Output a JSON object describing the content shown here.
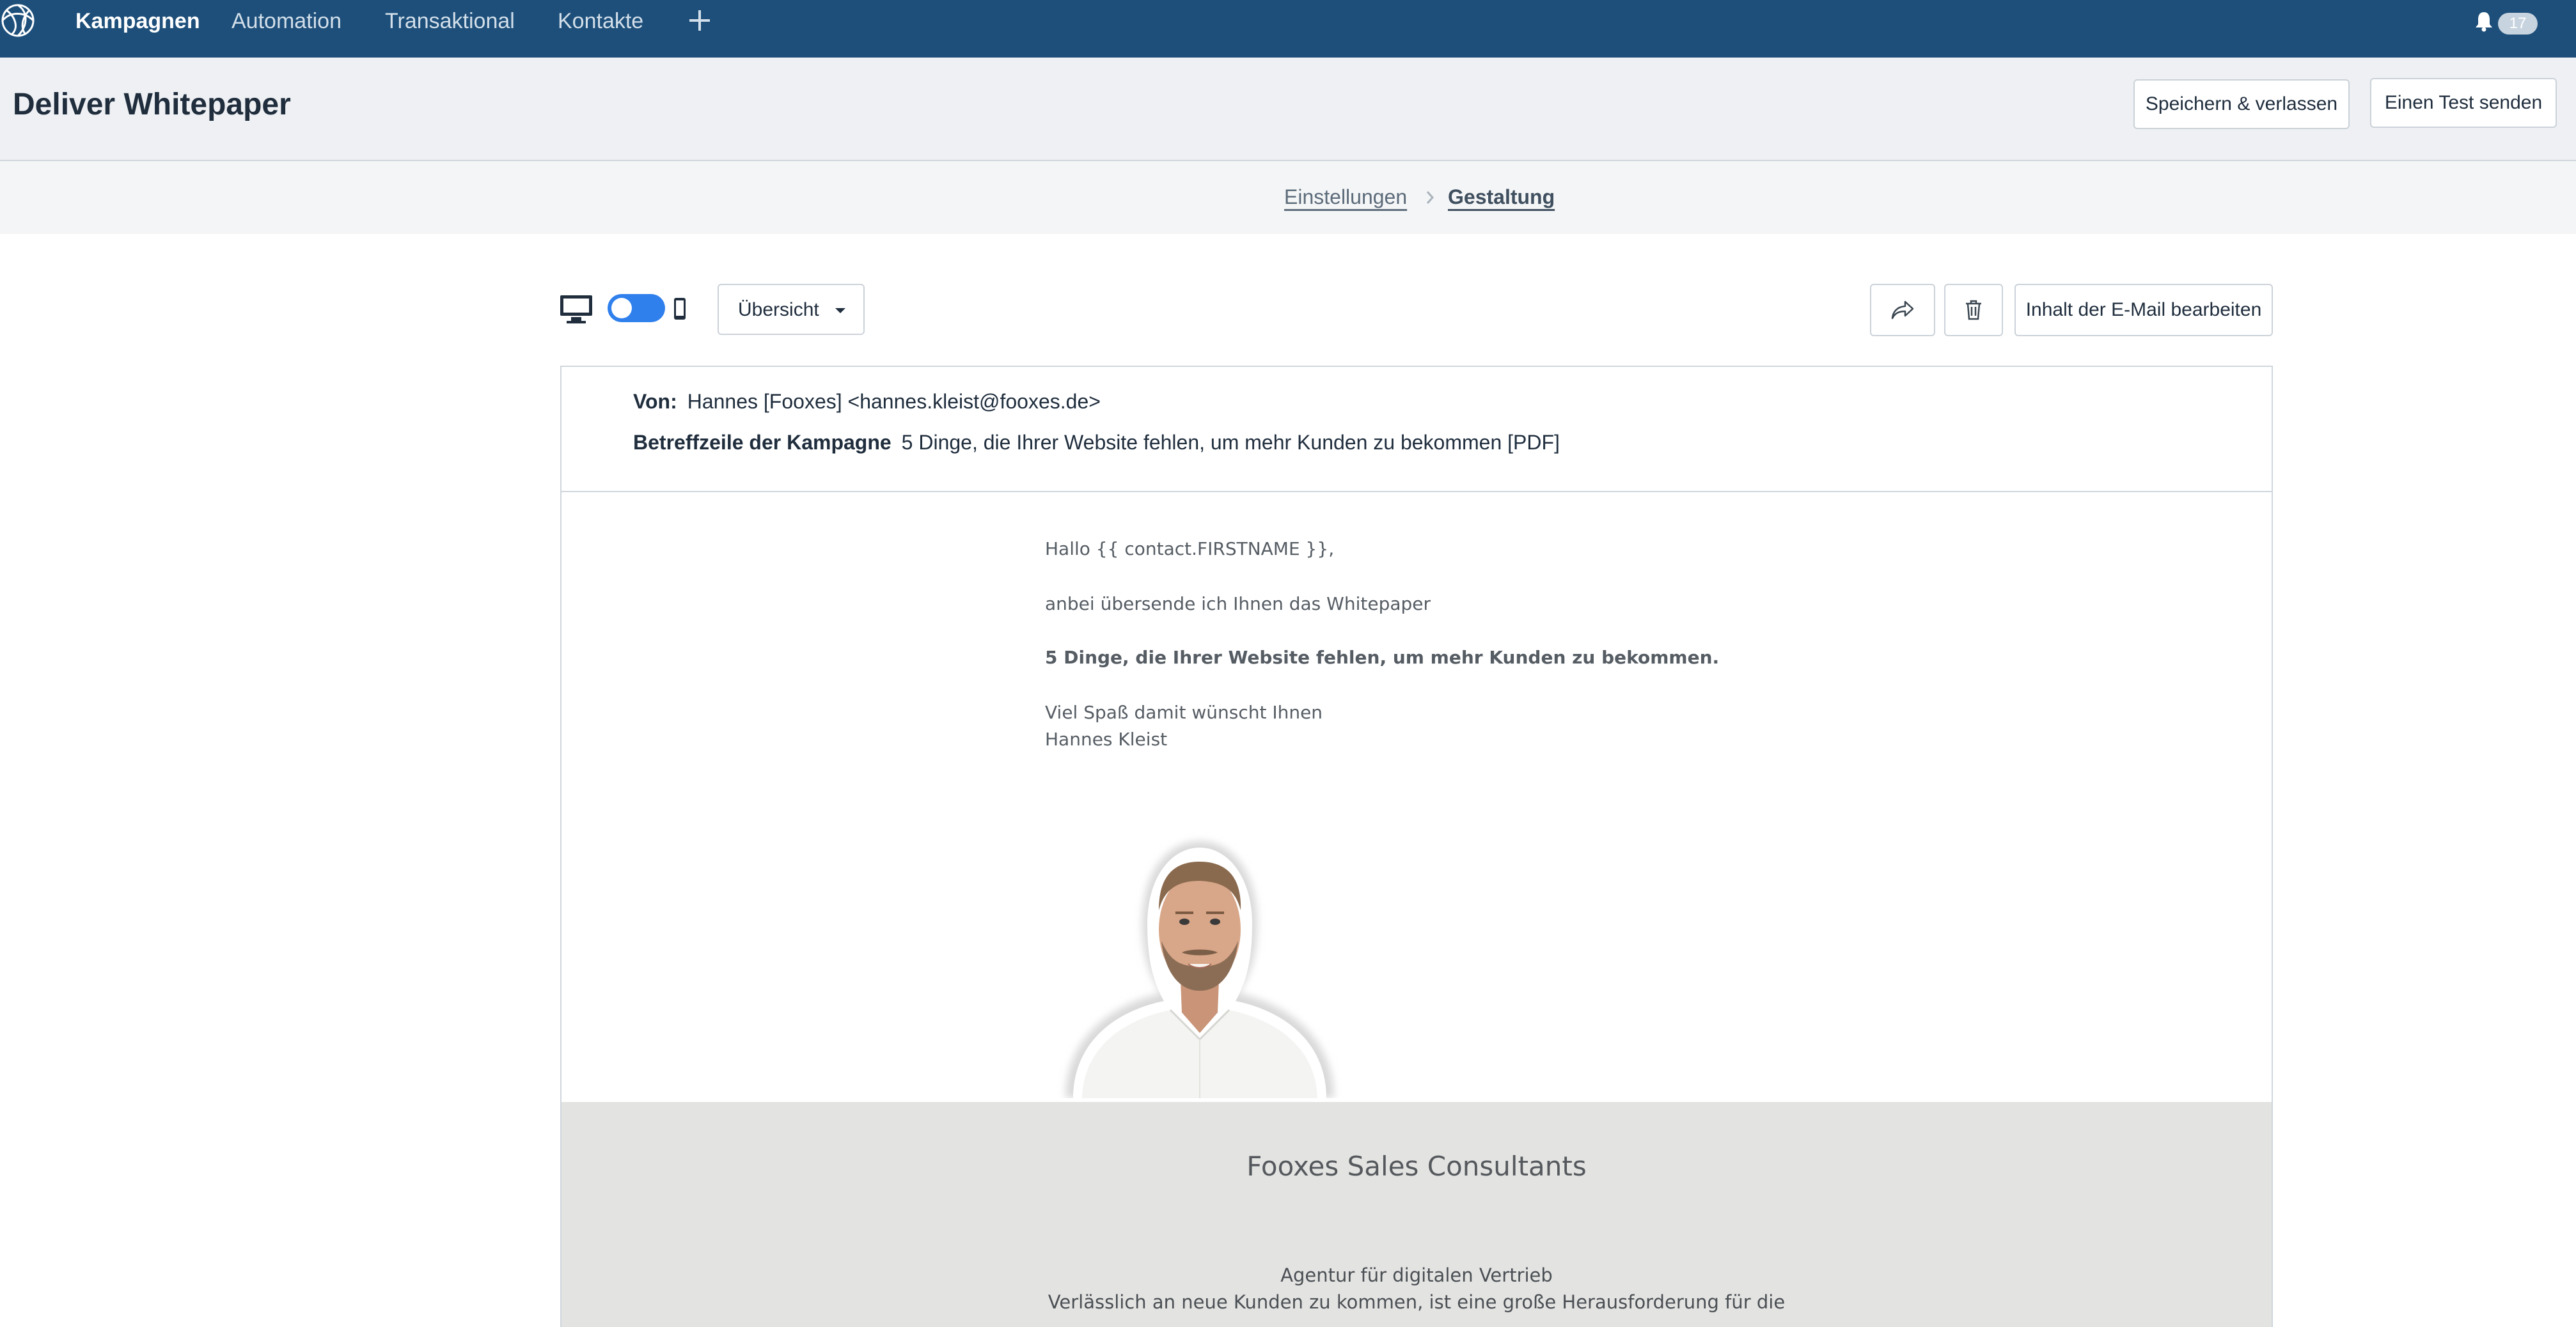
{
  "nav": {
    "items": [
      {
        "label": "Kampagnen",
        "active": true
      },
      {
        "label": "Automation",
        "active": false
      },
      {
        "label": "Transaktional",
        "active": false
      },
      {
        "label": "Kontakte",
        "active": false
      }
    ],
    "plus_icon": "plus-icon",
    "notifications_count": "17",
    "colors": {
      "nav_bg": "#1d4f7a",
      "accent": "#2f80ed"
    }
  },
  "header": {
    "title": "Deliver Whitepaper",
    "save_label": "Speichern & verlassen",
    "test_label": "Einen Test senden"
  },
  "breadcrumb": {
    "step1": "Einstellungen",
    "step2": "Gestaltung"
  },
  "toolbar": {
    "view_select": "Übersicht",
    "edit_label": "Inhalt der E-Mail bearbeiten",
    "device_toggle": "desktop"
  },
  "email": {
    "from_label": "Von:",
    "from_value": "Hannes [Fooxes] <hannes.kleist@fooxes.de>",
    "subject_label": "Betreffzeile der Kampagne",
    "subject_value": "5 Dinge, die Ihrer Website fehlen, um mehr Kunden zu bekommen [PDF]",
    "body": {
      "greeting": "Hallo {{ contact.FIRSTNAME }},",
      "intro": "anbei übersende ich Ihnen das Whitepaper",
      "title": "5 Dinge, die Ihrer Website fehlen, um mehr Kunden zu bekommen.",
      "closing": "Viel Spaß damit wünscht Ihnen",
      "signature": "Hannes Kleist"
    },
    "footer": {
      "company": "Fooxes Sales Consultants",
      "tagline": "Agentur für digitalen Vertrieb",
      "text": "Verlässlich an neue Kunden zu kommen, ist eine große Herausforderung für die"
    }
  }
}
